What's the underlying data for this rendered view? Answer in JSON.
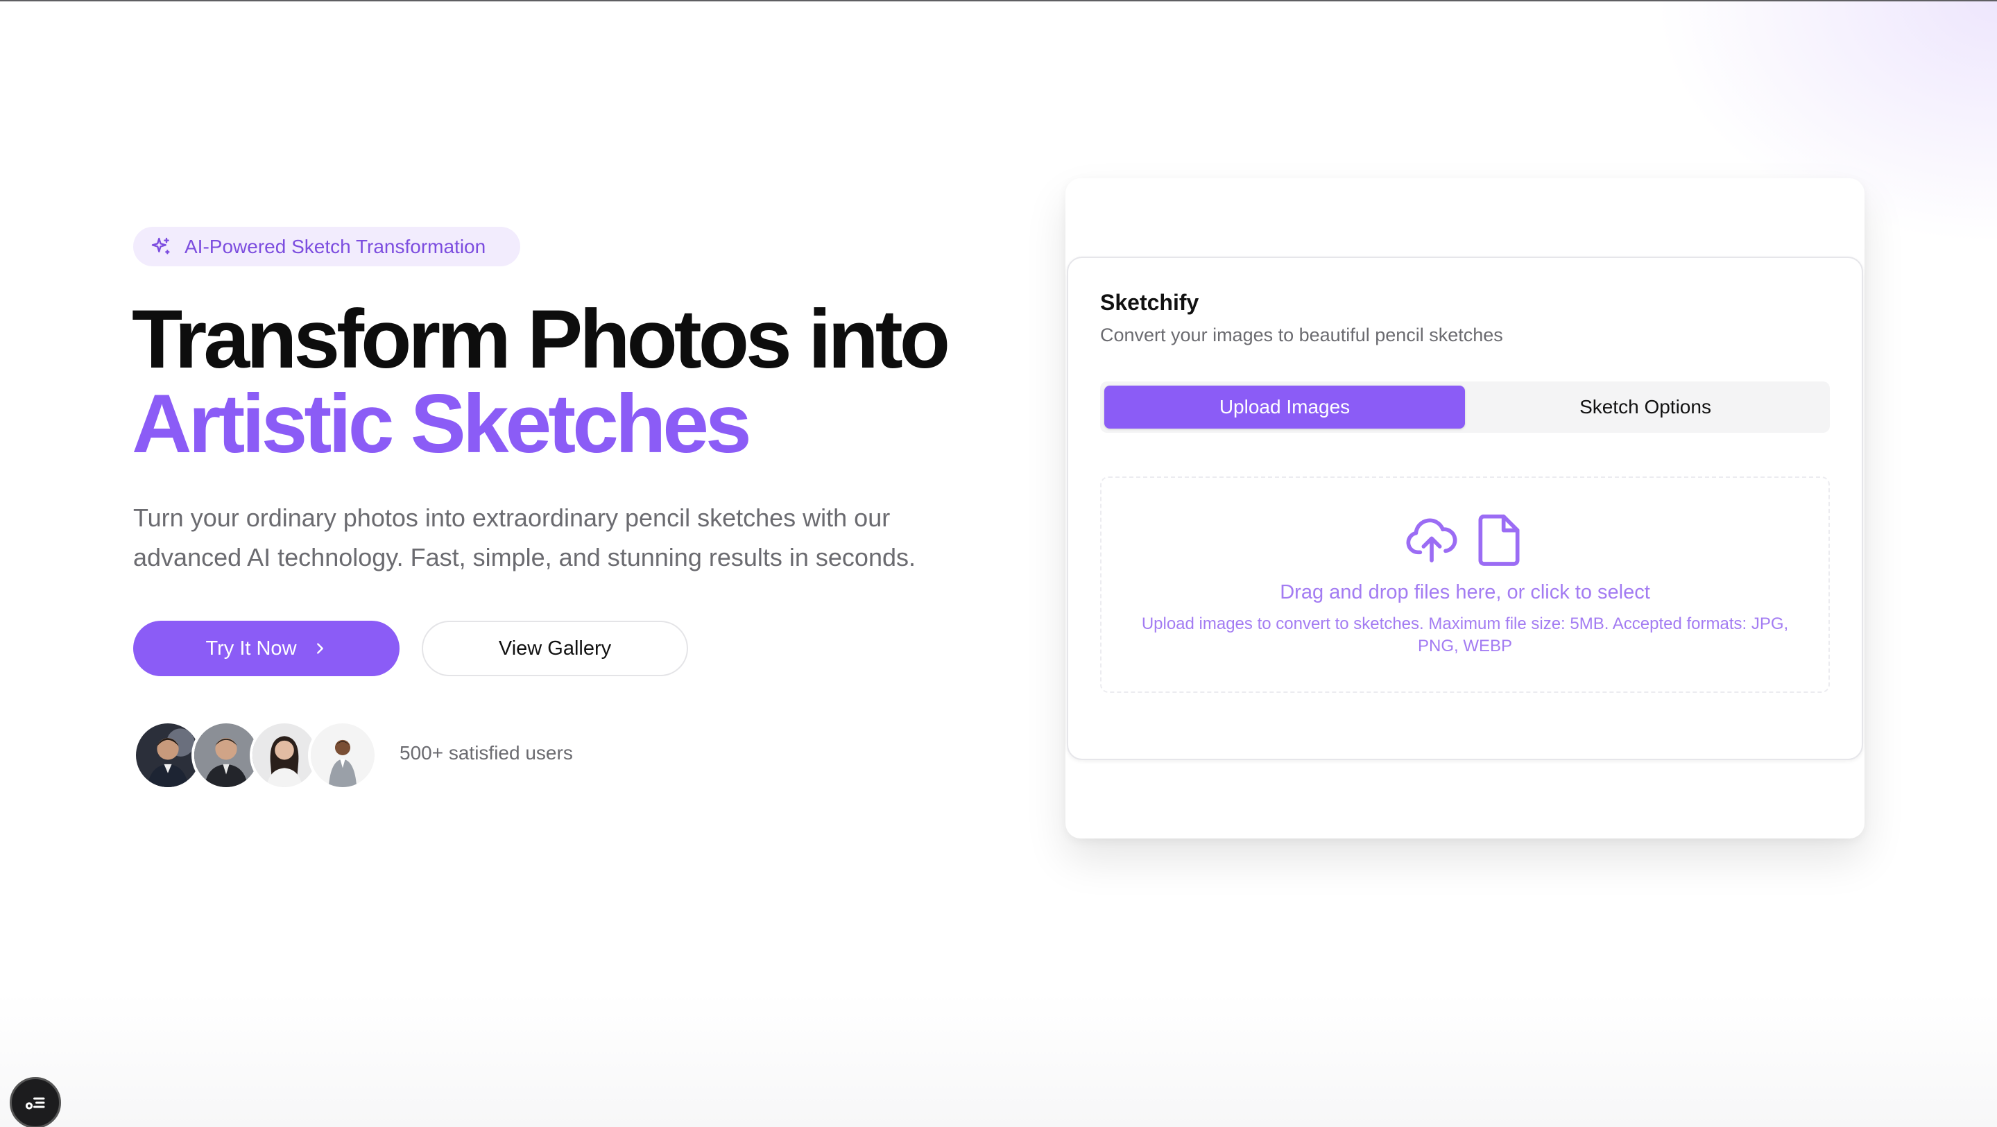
{
  "hero": {
    "badge_icon": "sparkles-icon",
    "badge_text": "AI-Powered Sketch Transformation",
    "headline_line1": "Transform Photos into",
    "headline_line2": "Artistic Sketches",
    "description": "Turn your ordinary photos into extraordinary pencil sketches with our advanced AI technology. Fast, simple, and stunning results in seconds.",
    "primary_button": "Try It Now",
    "primary_button_icon": "chevron-right-icon",
    "secondary_button": "View Gallery",
    "users_text": "500+ satisfied users",
    "avatars": [
      "user-avatar-1",
      "user-avatar-2",
      "user-avatar-3",
      "user-avatar-4"
    ]
  },
  "app": {
    "title": "Sketchify",
    "subtitle": "Convert your images to beautiful pencil sketches",
    "tabs": [
      {
        "label": "Upload Images",
        "active": true
      },
      {
        "label": "Sketch Options",
        "active": false
      }
    ],
    "dropzone": {
      "icons": [
        "cloud-upload-icon",
        "file-icon"
      ],
      "main_text": "Drag and drop files here, or click to select",
      "help_text": "Upload images to convert to sketches. Maximum file size: 5MB. Accepted formats: JPG, PNG, WEBP"
    }
  },
  "floating_button_icon": "menu-list-icon",
  "colors": {
    "accent": "#8b5cf6",
    "accent_soft": "#f2ecfd",
    "text_dark": "#0d0d0d",
    "text_muted": "#6b6b70",
    "dropzone_text": "#a37cf2"
  }
}
